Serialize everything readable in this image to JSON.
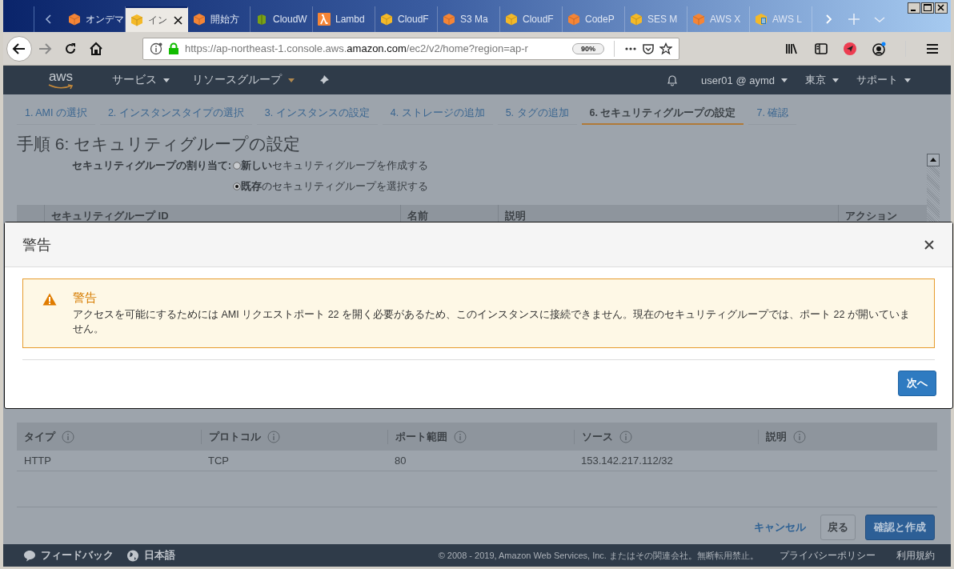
{
  "browser": {
    "tabs": [
      {
        "label": "オンデマ",
        "kind": "orange",
        "selected": false
      },
      {
        "label": "イン",
        "kind": "yellow",
        "selected": true
      },
      {
        "label": "開始方",
        "kind": "orange",
        "selected": false
      },
      {
        "label": "CloudW",
        "kind": "green",
        "selected": false
      },
      {
        "label": "Lambd",
        "kind": "lambda",
        "selected": false
      },
      {
        "label": "CloudF",
        "kind": "yellow",
        "selected": false
      },
      {
        "label": "S3 Ma",
        "kind": "orange",
        "selected": false
      },
      {
        "label": "CloudF",
        "kind": "yellow",
        "selected": false
      },
      {
        "label": "CodeP",
        "kind": "orange",
        "selected": false
      },
      {
        "label": "SES M",
        "kind": "yellow",
        "selected": false
      },
      {
        "label": "AWS X",
        "kind": "orange",
        "selected": false
      },
      {
        "label": "AWS L",
        "kind": "doc",
        "selected": false
      }
    ],
    "url": {
      "start": "https://ap-northeast-1.console.aws.",
      "domain": "amazon.com",
      "rest": "/ec2/v2/home?region=ap-r"
    },
    "zoom": "90%"
  },
  "console_nav": {
    "logo": "aws",
    "menus": [
      "サービス",
      "リソースグループ"
    ],
    "user": "user01 @ aymd",
    "region": "東京",
    "support": "サポート"
  },
  "steps": [
    {
      "label": "1. AMI の選択",
      "selected": false
    },
    {
      "label": "2. インスタンスタイプの選択",
      "selected": false
    },
    {
      "label": "3. インスタンスの設定",
      "selected": false
    },
    {
      "label": "4. ストレージの追加",
      "selected": false
    },
    {
      "label": "5. タグの追加",
      "selected": false
    },
    {
      "label": "6. セキュリティグループの設定",
      "selected": true
    },
    {
      "label": "7. 確認",
      "selected": false
    }
  ],
  "title": "手順 6: セキュリティグループの設定",
  "assign": {
    "label": "セキュリティグループの割り当て:",
    "options": [
      {
        "label": "**新しい**セキュリティグループを作成する",
        "selected": false
      },
      {
        "label": "**既存**のセキュリティグループを選択する",
        "selected": true
      }
    ]
  },
  "group_table": {
    "columns": [
      "セキュリティグループ ID",
      "名前",
      "説明",
      "アクション"
    ]
  },
  "dialog": {
    "title": "警告",
    "alert": {
      "heading": "警告",
      "text": "アクセスを可能にするためには AMI リクエストポート 22 を開く必要があるため、このインスタンスに接続できません。現在のセキュリティグループでは、ポート 22 が開いていません。"
    },
    "button": "次へ"
  },
  "rules_table": {
    "columns": [
      "タイプ",
      "プロトコル",
      "ポート範囲",
      "ソース",
      "説明"
    ],
    "rows": [
      {
        "type": "HTTP",
        "protocol": "TCP",
        "port_range": "80",
        "source": "153.142.217.112/32"
      }
    ]
  },
  "actions": {
    "cancel": "キャンセル",
    "back": "戻る",
    "create": "確認と作成"
  },
  "footer": {
    "feedback": "フィードバック",
    "language": "日本語",
    "copyright": "© 2008 - 2019, Amazon Web Services, Inc. またはその関連会社。無断転用禁止。",
    "links": [
      "プライバシーポリシー",
      "利用規約"
    ]
  }
}
